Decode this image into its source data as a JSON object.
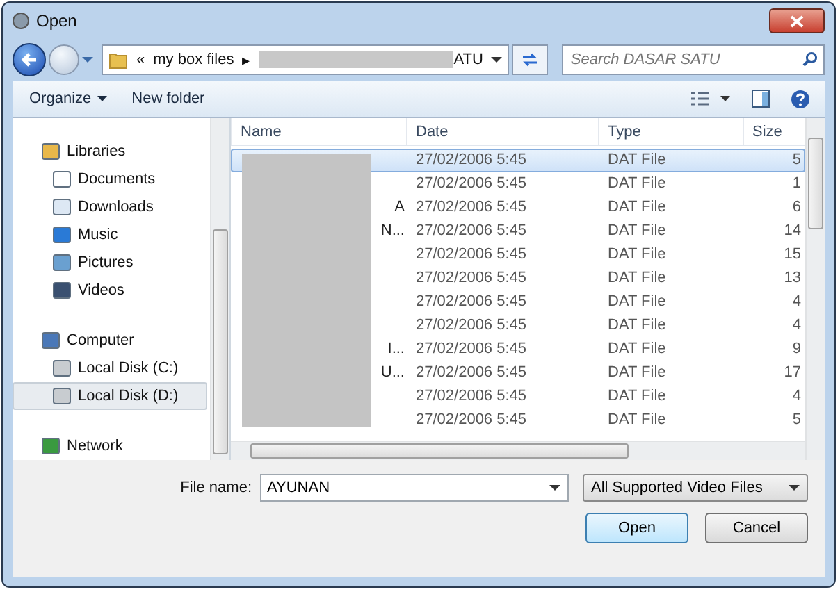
{
  "window": {
    "title": "Open"
  },
  "address": {
    "parts": [
      "«",
      "my box files",
      "▸"
    ],
    "tail": "ATU"
  },
  "search": {
    "placeholder": "Search DASAR SATU"
  },
  "toolbar": {
    "organize": "Organize",
    "new_folder": "New folder"
  },
  "sidebar": {
    "groups": [
      {
        "label": "Libraries",
        "children": [
          {
            "label": "Documents",
            "selected": false
          },
          {
            "label": "Downloads",
            "selected": false
          },
          {
            "label": "Music",
            "selected": false
          },
          {
            "label": "Pictures",
            "selected": false
          },
          {
            "label": "Videos",
            "selected": false
          }
        ]
      },
      {
        "label": "Computer",
        "children": [
          {
            "label": "Local Disk (C:)",
            "selected": false
          },
          {
            "label": "Local Disk (D:)",
            "selected": true
          }
        ]
      },
      {
        "label": "Network"
      }
    ]
  },
  "table": {
    "columns": [
      "Name",
      "Date",
      "Type",
      "Size"
    ],
    "rows": [
      {
        "name": "",
        "date": "27/02/2006 5:45",
        "type": "DAT File",
        "size": "5",
        "selected": true
      },
      {
        "name": "",
        "date": "27/02/2006 5:45",
        "type": "DAT File",
        "size": "1",
        "selected": false
      },
      {
        "name": "A",
        "date": "27/02/2006 5:45",
        "type": "DAT File",
        "size": "6",
        "selected": false
      },
      {
        "name": "N...",
        "date": "27/02/2006 5:45",
        "type": "DAT File",
        "size": "14",
        "selected": false
      },
      {
        "name": "",
        "date": "27/02/2006 5:45",
        "type": "DAT File",
        "size": "15",
        "selected": false
      },
      {
        "name": "",
        "date": "27/02/2006 5:45",
        "type": "DAT File",
        "size": "13",
        "selected": false
      },
      {
        "name": "",
        "date": "27/02/2006 5:45",
        "type": "DAT File",
        "size": "4",
        "selected": false
      },
      {
        "name": "",
        "date": "27/02/2006 5:45",
        "type": "DAT File",
        "size": "4",
        "selected": false
      },
      {
        "name": "I...",
        "date": "27/02/2006 5:45",
        "type": "DAT File",
        "size": "9",
        "selected": false
      },
      {
        "name": "U...",
        "date": "27/02/2006 5:45",
        "type": "DAT File",
        "size": "17",
        "selected": false
      },
      {
        "name": "",
        "date": "27/02/2006 5:45",
        "type": "DAT File",
        "size": "4",
        "selected": false
      },
      {
        "name": "",
        "date": "27/02/2006 5:45",
        "type": "DAT File",
        "size": "5",
        "selected": false
      }
    ]
  },
  "file_name": {
    "label": "File name:",
    "value": "AYUNAN"
  },
  "file_type": {
    "value": "All Supported Video Files"
  },
  "buttons": [
    {
      "label": "Open",
      "kind": "primary"
    },
    {
      "label": "Cancel",
      "kind": "normal"
    }
  ]
}
